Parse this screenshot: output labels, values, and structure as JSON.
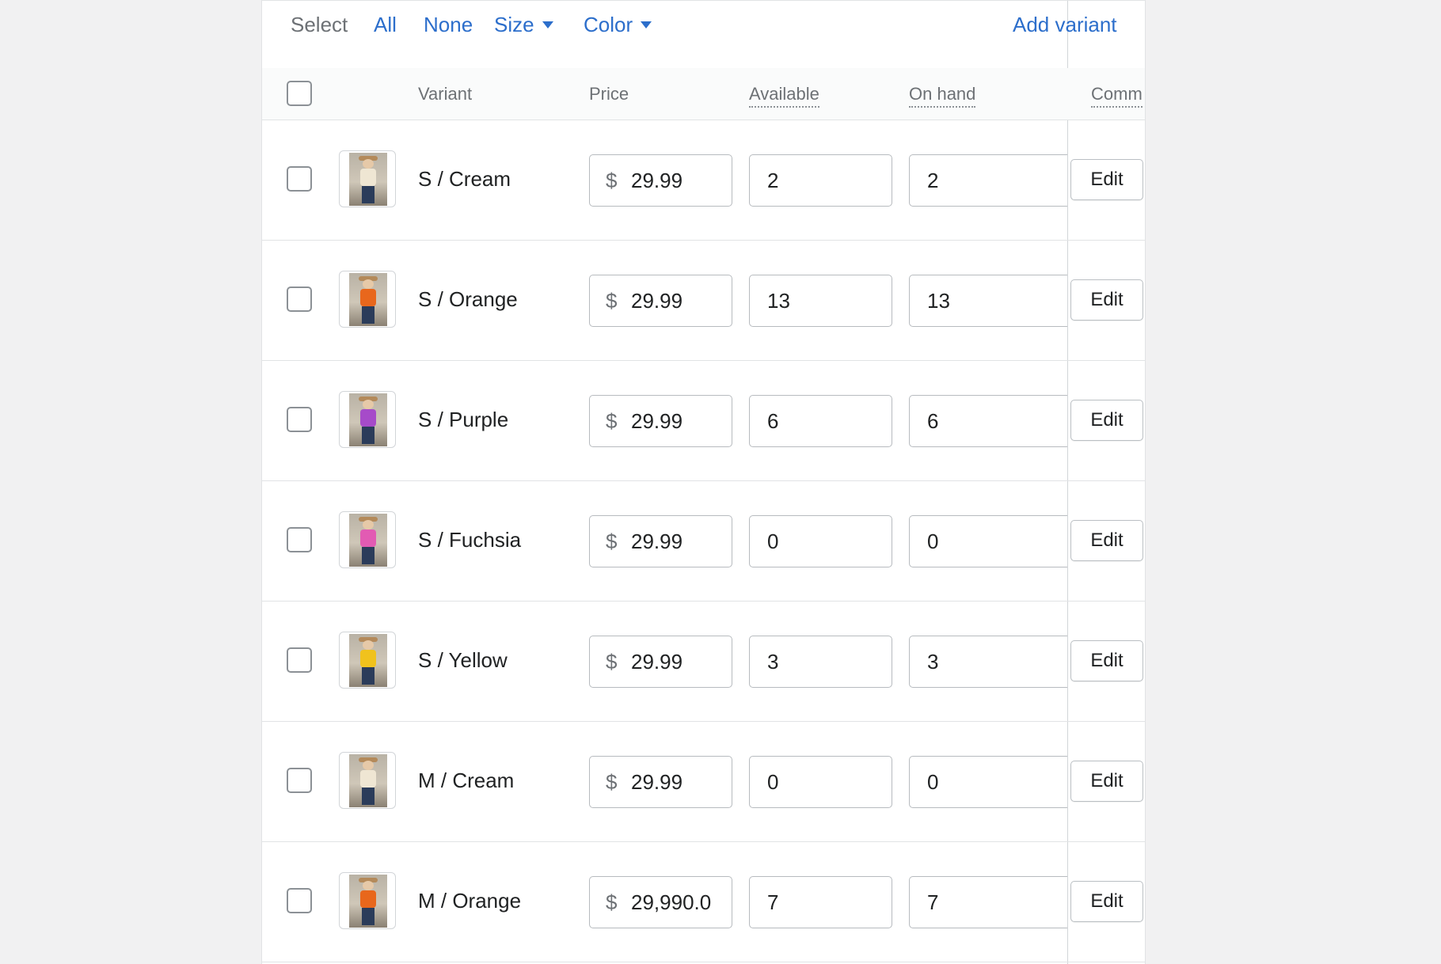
{
  "toolbar": {
    "select_label": "Select",
    "all": "All",
    "none": "None",
    "size": "Size",
    "color": "Color",
    "add_variant": "Add variant"
  },
  "columns": {
    "variant": "Variant",
    "price": "Price",
    "available": "Available",
    "on_hand": "On hand",
    "committed": "Comm"
  },
  "currency_symbol": "$",
  "edit_label": "Edit",
  "variants": [
    {
      "name": "S / Cream",
      "price": "29.99",
      "available": "2",
      "on_hand": "2",
      "shirt_color": "#efe6d3"
    },
    {
      "name": "S / Orange",
      "price": "29.99",
      "available": "13",
      "on_hand": "13",
      "shirt_color": "#e8671c"
    },
    {
      "name": "S / Purple",
      "price": "29.99",
      "available": "6",
      "on_hand": "6",
      "shirt_color": "#a64bc9"
    },
    {
      "name": "S / Fuchsia",
      "price": "29.99",
      "available": "0",
      "on_hand": "0",
      "shirt_color": "#e25bb3"
    },
    {
      "name": "S / Yellow",
      "price": "29.99",
      "available": "3",
      "on_hand": "3",
      "shirt_color": "#f0c21d"
    },
    {
      "name": "M / Cream",
      "price": "29.99",
      "available": "0",
      "on_hand": "0",
      "shirt_color": "#efe6d3"
    },
    {
      "name": "M / Orange",
      "price": "29,990.0",
      "available": "7",
      "on_hand": "7",
      "shirt_color": "#e8671c"
    }
  ]
}
